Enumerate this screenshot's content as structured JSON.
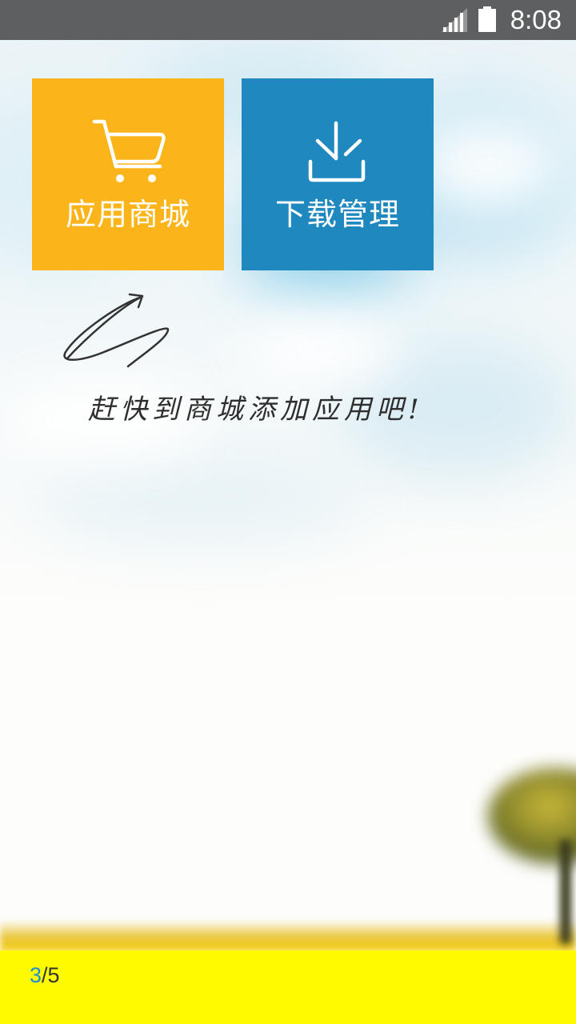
{
  "status_bar": {
    "time": "8:08",
    "icons": [
      "signal-icon",
      "battery-icon"
    ]
  },
  "tiles": [
    {
      "label": "应用商城",
      "icon": "cart-icon",
      "color": "#fbb419"
    },
    {
      "label": "下载管理",
      "icon": "download-icon",
      "color": "#1f88bf"
    }
  ],
  "hint": {
    "text": "赶快到商城添加应用吧!",
    "icon": "arrow-icon"
  },
  "pager": {
    "current": "3",
    "total": "/5"
  },
  "colors": {
    "status_bar": "#5e5f60",
    "bottom_bar": "#fefa00",
    "pager_current": "#1e8fd0"
  }
}
